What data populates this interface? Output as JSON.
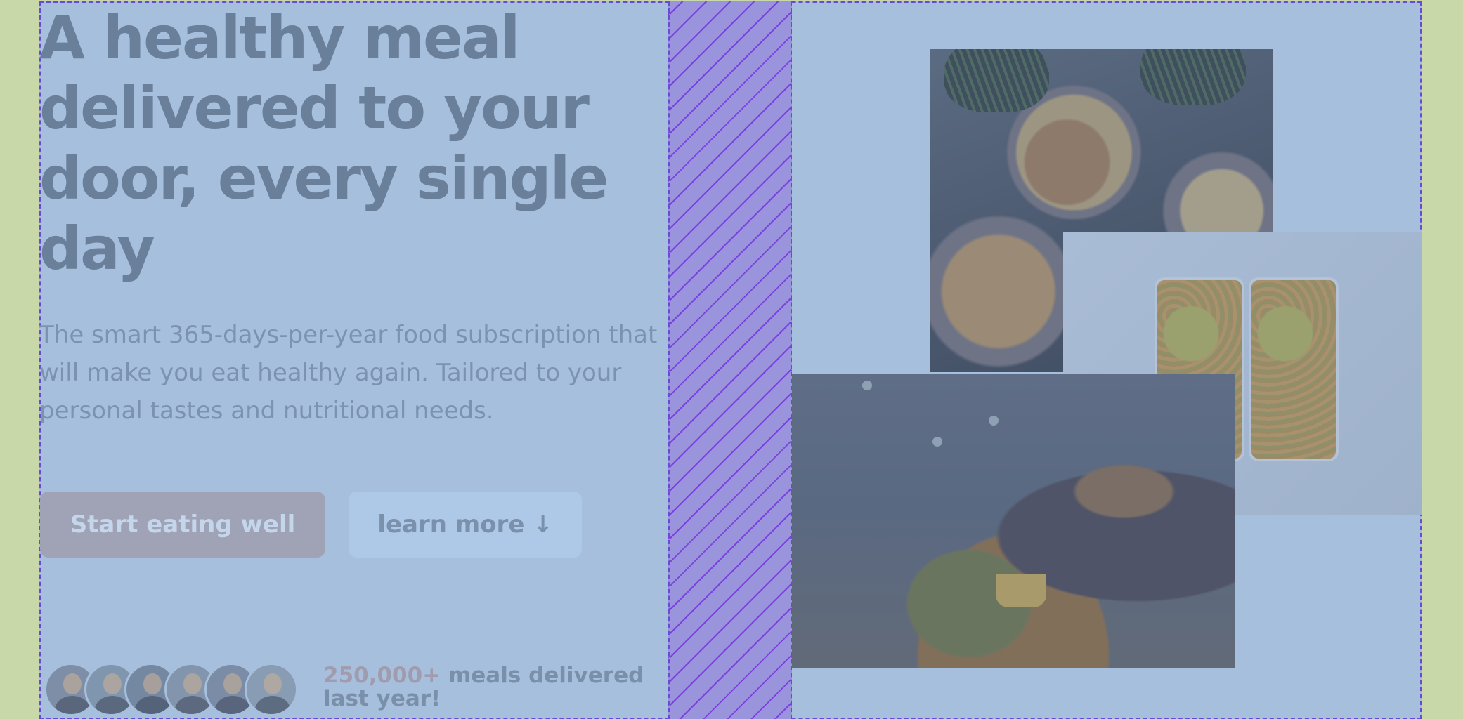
{
  "hero": {
    "title": "A healthy meal delivered to your door, every single day",
    "description": "The smart 365-days-per-year food subscription that will make you eat healthy again. Tailored to your personal tastes and nutritional needs.",
    "primary_button": "Start eating well",
    "secondary_button": "learn more ↓"
  },
  "delivered": {
    "count": "250,000+",
    "text": " meals delivered last year!"
  },
  "avatars": [
    "customer-1",
    "customer-2",
    "customer-3",
    "customer-4",
    "customer-5",
    "customer-6"
  ],
  "colors": {
    "page_background": "#c9d8a8",
    "section_background": "#a6bfdc",
    "gap_column": "#9a94dc",
    "grid_outline": "#6a49d8",
    "primary_button": "#a0a2b5",
    "secondary_button": "#aec9e8",
    "heading_text": "#6a7f99"
  }
}
